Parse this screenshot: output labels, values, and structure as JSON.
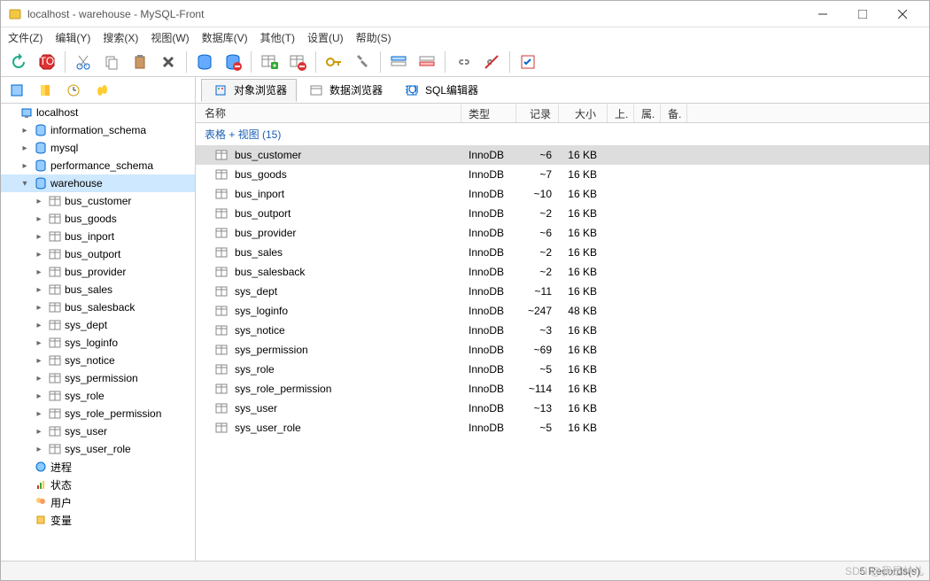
{
  "window": {
    "title": "localhost - warehouse - MySQL-Front"
  },
  "menu": [
    "文件(Z)",
    "编辑(Y)",
    "搜索(X)",
    "视图(W)",
    "数据库(V)",
    "其他(T)",
    "设置(U)",
    "帮助(S)"
  ],
  "tabs": [
    {
      "label": "对象浏览器",
      "active": true
    },
    {
      "label": "数据浏览器",
      "active": false
    },
    {
      "label": "SQL编辑器",
      "active": false
    }
  ],
  "tree": {
    "root": "localhost",
    "databases": [
      {
        "name": "information_schema",
        "expanded": false
      },
      {
        "name": "mysql",
        "expanded": false
      },
      {
        "name": "performance_schema",
        "expanded": false
      },
      {
        "name": "warehouse",
        "expanded": true,
        "selected": true
      }
    ],
    "warehouse_tables": [
      "bus_customer",
      "bus_goods",
      "bus_inport",
      "bus_outport",
      "bus_provider",
      "bus_sales",
      "bus_salesback",
      "sys_dept",
      "sys_loginfo",
      "sys_notice",
      "sys_permission",
      "sys_role",
      "sys_role_permission",
      "sys_user",
      "sys_user_role"
    ],
    "extras": [
      "进程",
      "状态",
      "用户",
      "变量"
    ]
  },
  "grid": {
    "columns": [
      "名称",
      "类型",
      "记录",
      "大小",
      "上.",
      "属.",
      "备."
    ],
    "caption": "表格 + 视图 (15)",
    "rows": [
      {
        "name": "bus_customer",
        "type": "InnoDB",
        "rec": "~6",
        "size": "16 KB",
        "selected": true
      },
      {
        "name": "bus_goods",
        "type": "InnoDB",
        "rec": "~7",
        "size": "16 KB"
      },
      {
        "name": "bus_inport",
        "type": "InnoDB",
        "rec": "~10",
        "size": "16 KB"
      },
      {
        "name": "bus_outport",
        "type": "InnoDB",
        "rec": "~2",
        "size": "16 KB"
      },
      {
        "name": "bus_provider",
        "type": "InnoDB",
        "rec": "~6",
        "size": "16 KB"
      },
      {
        "name": "bus_sales",
        "type": "InnoDB",
        "rec": "~2",
        "size": "16 KB"
      },
      {
        "name": "bus_salesback",
        "type": "InnoDB",
        "rec": "~2",
        "size": "16 KB"
      },
      {
        "name": "sys_dept",
        "type": "InnoDB",
        "rec": "~11",
        "size": "16 KB"
      },
      {
        "name": "sys_loginfo",
        "type": "InnoDB",
        "rec": "~247",
        "size": "48 KB"
      },
      {
        "name": "sys_notice",
        "type": "InnoDB",
        "rec": "~3",
        "size": "16 KB"
      },
      {
        "name": "sys_permission",
        "type": "InnoDB",
        "rec": "~69",
        "size": "16 KB"
      },
      {
        "name": "sys_role",
        "type": "InnoDB",
        "rec": "~5",
        "size": "16 KB"
      },
      {
        "name": "sys_role_permission",
        "type": "InnoDB",
        "rec": "~114",
        "size": "16 KB"
      },
      {
        "name": "sys_user",
        "type": "InnoDB",
        "rec": "~13",
        "size": "16 KB"
      },
      {
        "name": "sys_user_role",
        "type": "InnoDB",
        "rec": "~5",
        "size": "16 KB"
      }
    ]
  },
  "status": "5 Records(s)",
  "watermark": "SDN @我是林儿"
}
